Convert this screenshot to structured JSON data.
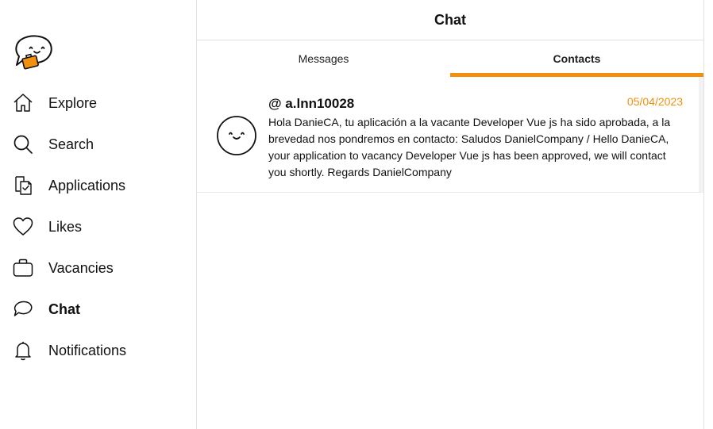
{
  "sidebar": {
    "logo_icon": "chat-bubble-briefcase-logo",
    "items": [
      {
        "label": "Explore",
        "icon": "home-icon",
        "active": false
      },
      {
        "label": "Search",
        "icon": "search-icon",
        "active": false
      },
      {
        "label": "Applications",
        "icon": "applications-icon",
        "active": false
      },
      {
        "label": "Likes",
        "icon": "heart-icon",
        "active": false
      },
      {
        "label": "Vacancies",
        "icon": "briefcase-icon",
        "active": false
      },
      {
        "label": "Chat",
        "icon": "chat-icon",
        "active": true
      },
      {
        "label": "Notifications",
        "icon": "bell-icon",
        "active": false
      }
    ]
  },
  "header": {
    "title": "Chat"
  },
  "tabs": [
    {
      "label": "Messages",
      "active": false
    },
    {
      "label": "Contacts",
      "active": true
    }
  ],
  "chats": [
    {
      "name": "@ a.lnn10028",
      "date": "05/04/2023",
      "avatar_icon": "smiley-face-avatar",
      "message": "Hola DanieCA, tu aplicación a la vacante Developer Vue js ha sido aprobada, a la brevedad nos pondremos en contacto: Saludos DanielCompany / Hello DanieCA, your application to vacancy Developer Vue js has been approved, we will contact you shortly. Regards DanielCompany"
    }
  ],
  "colors": {
    "accent": "#f0900c",
    "text": "#111111",
    "border": "#e3e3e3"
  }
}
